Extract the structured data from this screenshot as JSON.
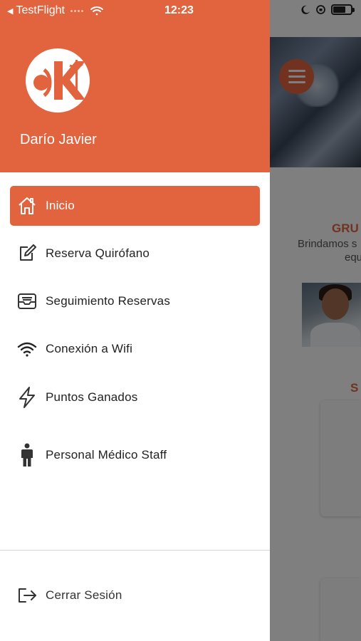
{
  "status_bar": {
    "back_app": "TestFlight",
    "time": "12:23",
    "battery_percent": 70
  },
  "background": {
    "section_title": "GRU",
    "subtitle_line1": "Brindamos s",
    "subtitle_line2": "equ",
    "section2_title": "S"
  },
  "drawer": {
    "user_name": "Darío Javier",
    "items": [
      {
        "label": "Inicio",
        "icon": "home-icon",
        "active": true
      },
      {
        "label": "Reserva Quirófano",
        "icon": "edit-icon",
        "active": false
      },
      {
        "label": "Seguimiento Reservas",
        "icon": "tray-icon",
        "active": false
      },
      {
        "label": "Conexión a Wifi",
        "icon": "wifi-icon",
        "active": false
      },
      {
        "label": "Puntos Ganados",
        "icon": "lightning-icon",
        "active": false
      },
      {
        "label": "Personal Médico Staff",
        "icon": "person-icon",
        "active": false
      }
    ],
    "logout_label": "Cerrar Sesión"
  },
  "colors": {
    "accent": "#e2643f",
    "drawer_bg": "#ffffff",
    "text": "#222222"
  }
}
